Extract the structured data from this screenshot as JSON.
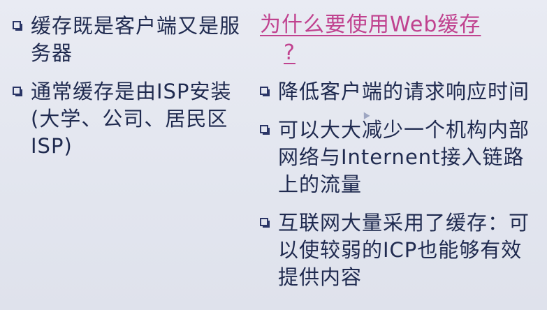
{
  "left": {
    "items": [
      "缓存既是客户端又是服务器",
      "通常缓存是由ISP安装 (大学、公司、居民区ISP)"
    ]
  },
  "right": {
    "title": {
      "main": "为什么要使用Web缓存",
      "q": "?"
    },
    "items": [
      "降低客户端的请求响应时间",
      "可以大大减少一个机构内部网络与Internent接入链路上的流量",
      "互联网大量采用了缓存：可以使较弱的ICP也能够有效提供内容"
    ]
  },
  "colors": {
    "text": "#1f2a4f",
    "title": "#c0428f",
    "background": "#e6e8f0"
  }
}
